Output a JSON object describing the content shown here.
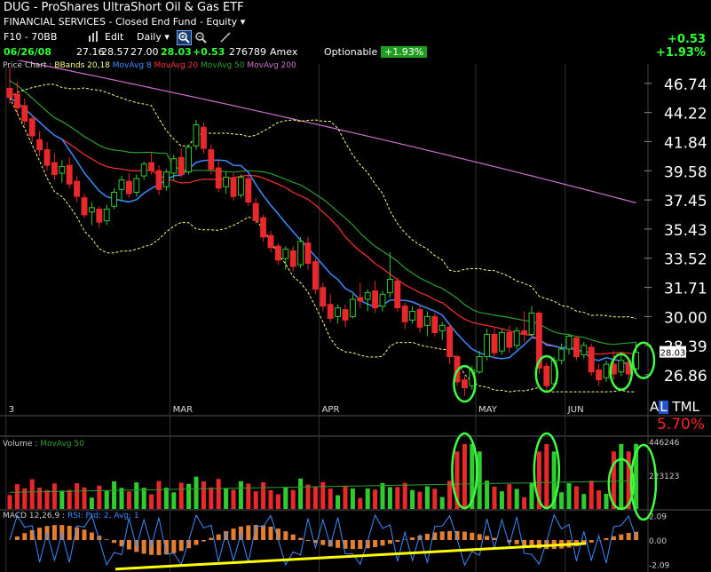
{
  "header": {
    "title": "DUG - ProShares UltraShort Oil & Gas ETF",
    "subtitle": "FINANCIAL SERVICES - Closed End Fund - Equity",
    "subtitle_arrow": "▾"
  },
  "toolbar": {
    "layout": "F10 - 70BB",
    "edit": "Edit",
    "period": "Daily"
  },
  "quote": {
    "date": "06/26/08",
    "open": "27.16",
    "high": "28.57",
    "low": "27.00",
    "last": "28.03",
    "change": "+0.53",
    "volume": "276789",
    "exchange": "Amex",
    "optionable": "Optionable",
    "change_pct": "+1.93%"
  },
  "right_panel": {
    "change": "+0.53",
    "change_pct": "+1.93%",
    "al_prefix": "A",
    "al_highlight": "L",
    "al_suffix": "TML",
    "pct": "5.70%"
  },
  "colors": {
    "up": "#2ecc2e",
    "down": "#e8282a",
    "bb": "#ffff80",
    "ma8": "#3c8cff",
    "ma20": "#ff3030",
    "ma50": "#2aa02a",
    "ma200": "#d070d0",
    "macd_hist": "#e08030",
    "rsi": "#3c8cff",
    "trend": "#ffff00",
    "circle": "#40ff40"
  },
  "chart_data": [
    {
      "type": "candlestick",
      "title": "Price Chart",
      "legend": [
        "BBands 20,18",
        "MovAvg 8",
        "MovAvg 20",
        "MovAvg 50",
        "MovAvg 200"
      ],
      "legend_prefix": "Price Chart",
      "y_ticks": [
        "46.74",
        "44.22",
        "41.84",
        "39.58",
        "37.45",
        "35.43",
        "33.52",
        "31.71",
        "30.00",
        "28.39",
        "26.86"
      ],
      "y_scale": "log",
      "ylim": [
        25.7,
        48.5
      ],
      "x_ticks": [
        "3",
        "MAR",
        "APR",
        "MAY",
        "JUN"
      ],
      "last_price_label": "28.03",
      "candles": [
        [
          46.3,
          48.2,
          45.0,
          45.5
        ],
        [
          45.8,
          46.9,
          44.1,
          44.6
        ],
        [
          44.8,
          45.4,
          43.1,
          43.5
        ],
        [
          43.7,
          44.0,
          41.8,
          42.3
        ],
        [
          42.0,
          42.7,
          40.7,
          41.2
        ],
        [
          41.2,
          41.8,
          39.6,
          40.0
        ],
        [
          40.2,
          40.9,
          38.9,
          39.3
        ],
        [
          39.4,
          40.4,
          38.7,
          39.9
        ],
        [
          40.0,
          40.6,
          38.3,
          38.6
        ],
        [
          38.8,
          39.2,
          37.3,
          37.7
        ],
        [
          37.6,
          37.9,
          36.2,
          36.4
        ],
        [
          36.6,
          37.3,
          35.7,
          36.9
        ],
        [
          36.8,
          37.0,
          35.5,
          35.9
        ],
        [
          36.0,
          37.1,
          35.7,
          36.8
        ],
        [
          37.0,
          38.3,
          36.8,
          38.0
        ],
        [
          38.2,
          39.2,
          37.4,
          38.9
        ],
        [
          38.8,
          39.4,
          37.6,
          37.9
        ],
        [
          38.0,
          39.3,
          37.7,
          39.0
        ],
        [
          39.2,
          40.3,
          38.9,
          40.1
        ],
        [
          40.2,
          41.0,
          39.3,
          39.6
        ],
        [
          39.6,
          40.0,
          37.8,
          38.2
        ],
        [
          38.4,
          39.7,
          38.1,
          39.5
        ],
        [
          39.4,
          40.8,
          38.9,
          40.5
        ],
        [
          40.6,
          41.3,
          39.1,
          39.3
        ],
        [
          39.5,
          41.6,
          39.3,
          41.4
        ],
        [
          41.5,
          43.6,
          41.2,
          43.2
        ],
        [
          43.0,
          43.4,
          40.9,
          41.3
        ],
        [
          41.2,
          41.6,
          39.3,
          39.7
        ],
        [
          39.8,
          40.4,
          38.0,
          38.3
        ],
        [
          38.4,
          39.5,
          37.9,
          39.1
        ],
        [
          39.0,
          39.4,
          37.4,
          37.7
        ],
        [
          37.8,
          39.3,
          37.6,
          39.1
        ],
        [
          39.0,
          39.2,
          37.0,
          37.3
        ],
        [
          37.2,
          37.6,
          35.8,
          36.0
        ],
        [
          36.2,
          36.4,
          34.6,
          34.9
        ],
        [
          35.0,
          35.3,
          33.9,
          34.2
        ],
        [
          34.3,
          34.5,
          33.1,
          33.4
        ],
        [
          33.5,
          34.3,
          32.8,
          34.1
        ],
        [
          34.0,
          34.3,
          32.7,
          33.0
        ],
        [
          33.1,
          34.9,
          32.9,
          34.6
        ],
        [
          34.5,
          34.9,
          32.8,
          33.2
        ],
        [
          33.3,
          33.5,
          31.3,
          31.6
        ],
        [
          31.7,
          32.0,
          30.3,
          30.6
        ],
        [
          30.7,
          31.3,
          29.7,
          29.9
        ],
        [
          30.0,
          30.7,
          29.6,
          30.5
        ],
        [
          30.4,
          30.7,
          29.4,
          29.8
        ],
        [
          30.0,
          31.3,
          29.9,
          31.0
        ],
        [
          31.1,
          32.0,
          30.5,
          30.9
        ],
        [
          31.0,
          31.6,
          30.3,
          31.4
        ],
        [
          31.5,
          32.1,
          30.2,
          30.5
        ],
        [
          30.6,
          31.5,
          30.3,
          31.3
        ],
        [
          31.4,
          33.9,
          31.1,
          32.2
        ],
        [
          32.1,
          32.3,
          30.3,
          30.5
        ],
        [
          30.6,
          30.8,
          29.3,
          29.7
        ],
        [
          29.8,
          30.6,
          29.6,
          30.3
        ],
        [
          30.4,
          30.7,
          29.1,
          29.4
        ],
        [
          29.5,
          30.3,
          28.9,
          30.0
        ],
        [
          30.0,
          30.2,
          28.9,
          29.1
        ],
        [
          29.2,
          29.7,
          28.7,
          29.5
        ],
        [
          29.4,
          29.6,
          27.4,
          27.8
        ],
        [
          27.8,
          27.9,
          26.3,
          26.5
        ],
        [
          26.6,
          26.8,
          25.8,
          26.2
        ],
        [
          26.3,
          27.3,
          26.1,
          27.1
        ],
        [
          27.0,
          28.1,
          26.9,
          27.8
        ],
        [
          27.8,
          29.3,
          27.6,
          29.0
        ],
        [
          29.0,
          29.4,
          27.7,
          28.0
        ],
        [
          28.1,
          29.3,
          27.9,
          29.1
        ],
        [
          29.1,
          29.5,
          28.0,
          28.3
        ],
        [
          28.4,
          29.4,
          28.2,
          29.2
        ],
        [
          29.2,
          30.3,
          28.6,
          29.0
        ],
        [
          29.0,
          30.6,
          28.9,
          30.2
        ],
        [
          30.2,
          30.3,
          26.9,
          27.2
        ],
        [
          27.3,
          27.5,
          26.0,
          26.3
        ],
        [
          26.4,
          27.8,
          26.2,
          27.6
        ],
        [
          27.6,
          28.5,
          27.4,
          28.2
        ],
        [
          28.2,
          29.0,
          27.9,
          28.9
        ],
        [
          28.8,
          28.9,
          27.6,
          27.8
        ],
        [
          27.9,
          28.6,
          27.7,
          28.4
        ],
        [
          28.3,
          28.5,
          26.8,
          27.0
        ],
        [
          27.1,
          27.4,
          26.3,
          26.6
        ],
        [
          26.7,
          27.6,
          26.5,
          27.4
        ],
        [
          27.4,
          28.1,
          26.6,
          26.9
        ],
        [
          27.0,
          28.0,
          26.8,
          27.6
        ],
        [
          27.5,
          27.6,
          26.6,
          26.9
        ],
        [
          27.16,
          28.57,
          27.0,
          28.03
        ]
      ],
      "annotations": "green ellipses highlighting volume surges"
    },
    {
      "type": "bar",
      "title": "Volume",
      "legend": [
        "MovAvg 50"
      ],
      "y_ticks": [
        "446246",
        "223123"
      ],
      "ylim": [
        0,
        470000
      ]
    },
    {
      "type": "line",
      "title": "MACD 12,26,9",
      "legend": [
        "RSI: Prd: 2, Avg: 1"
      ],
      "y_ticks": [
        "2.09",
        "0.00",
        "-2.09"
      ],
      "ylim": [
        -2.6,
        2.6
      ]
    }
  ]
}
